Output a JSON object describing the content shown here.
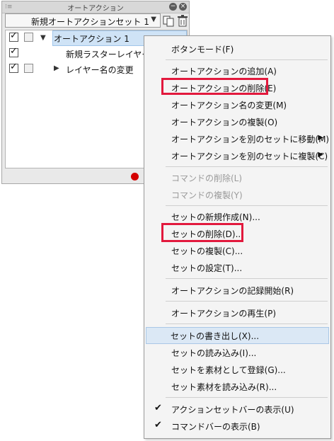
{
  "palette": {
    "title": "オートアクション",
    "set_selected": "新規オートアクションセット 1",
    "rows": [
      {
        "label": "オートアクション 1",
        "checked": true
      },
      {
        "label": "新規ラスターレイヤー",
        "checked": true
      },
      {
        "label": "レイヤー名の変更",
        "checked": true
      }
    ]
  },
  "menu": {
    "items": [
      "ボタンモード(F)",
      "オートアクションの追加(A)",
      "オートアクションの削除(E)",
      "オートアクション名の変更(M)",
      "オートアクションの複製(O)",
      "オートアクションを別のセットに移動(M)",
      "オートアクションを別のセットに複製(C)",
      "コマンドの削除(L)",
      "コマンドの複製(Y)",
      "セットの新規作成(N)...",
      "セットの削除(D)...",
      "セットの複製(C)...",
      "セットの設定(T)...",
      "オートアクションの記録開始(R)",
      "オートアクションの再生(P)",
      "セットの書き出し(X)...",
      "セットの読み込み(I)...",
      "セットを素材として登録(G)...",
      "セット素材を読み込み(R)...",
      "アクションセットバーの表示(U)",
      "コマンドバーの表示(B)"
    ]
  },
  "colors": {
    "highlight_box": "#e2193d",
    "record": "#d40000",
    "selection": "#cfe3f6"
  }
}
